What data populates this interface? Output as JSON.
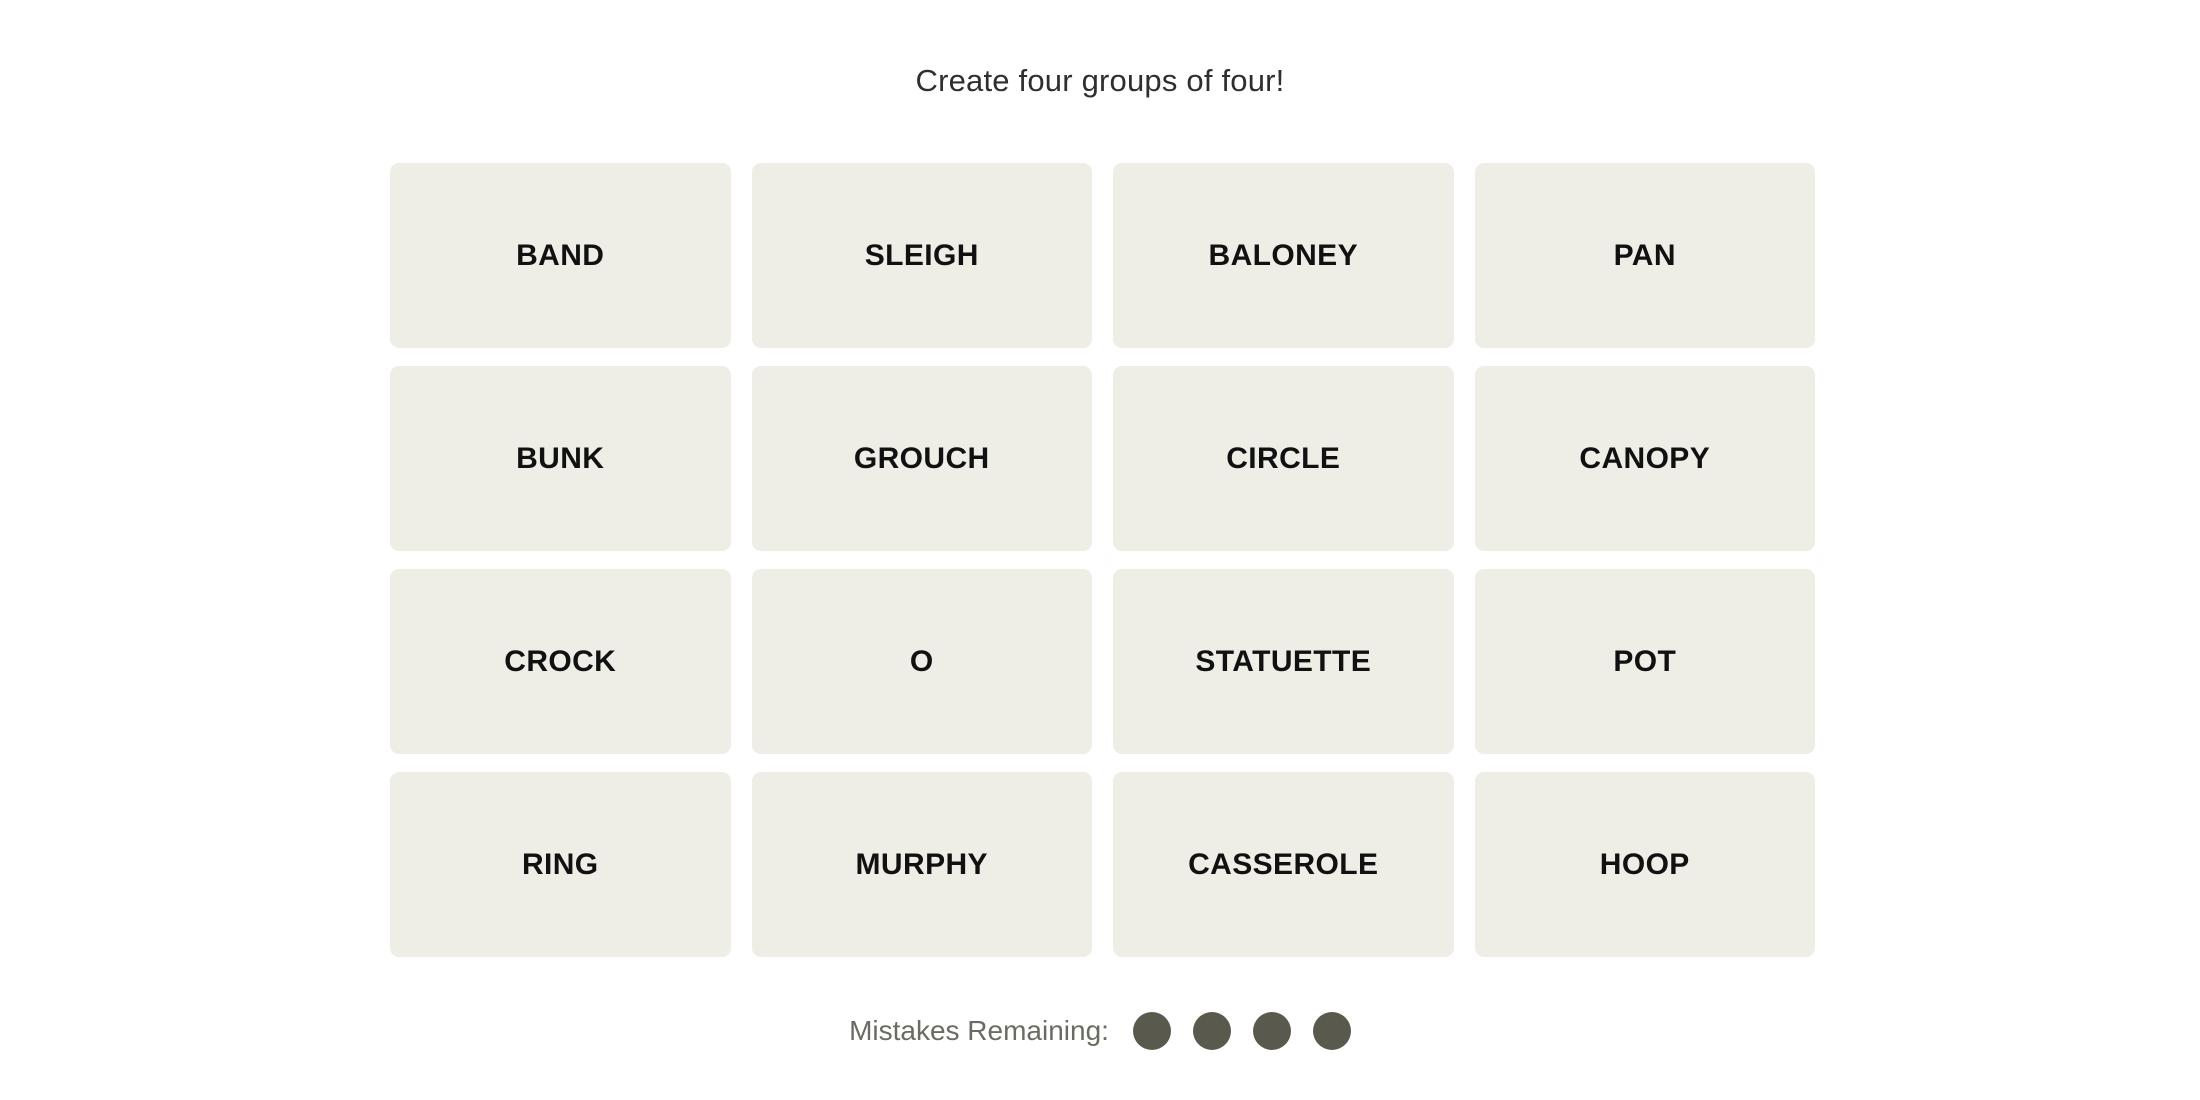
{
  "game": {
    "title": "Create four groups of four!",
    "tile_bg_color": "#eeeee6",
    "tile_text_color": "#111111",
    "page_bg_color": "#ffffff",
    "title_color": "#2f2f2f"
  },
  "board": {
    "rows": 4,
    "columns": 4,
    "tiles": [
      {
        "label": "BAND"
      },
      {
        "label": "SLEIGH"
      },
      {
        "label": "BALONEY"
      },
      {
        "label": "PAN"
      },
      {
        "label": "BUNK"
      },
      {
        "label": "GROUCH"
      },
      {
        "label": "CIRCLE"
      },
      {
        "label": "CANOPY"
      },
      {
        "label": "CROCK"
      },
      {
        "label": "O"
      },
      {
        "label": "STATUETTE"
      },
      {
        "label": "POT"
      },
      {
        "label": "RING"
      },
      {
        "label": "MURPHY"
      },
      {
        "label": "CASSEROLE"
      },
      {
        "label": "HOOP"
      }
    ]
  },
  "footer": {
    "mistakes_label": "Mistakes Remaining:",
    "mistakes_remaining": 4,
    "dot_color": "#595a4d",
    "label_color": "#6b6b61"
  }
}
